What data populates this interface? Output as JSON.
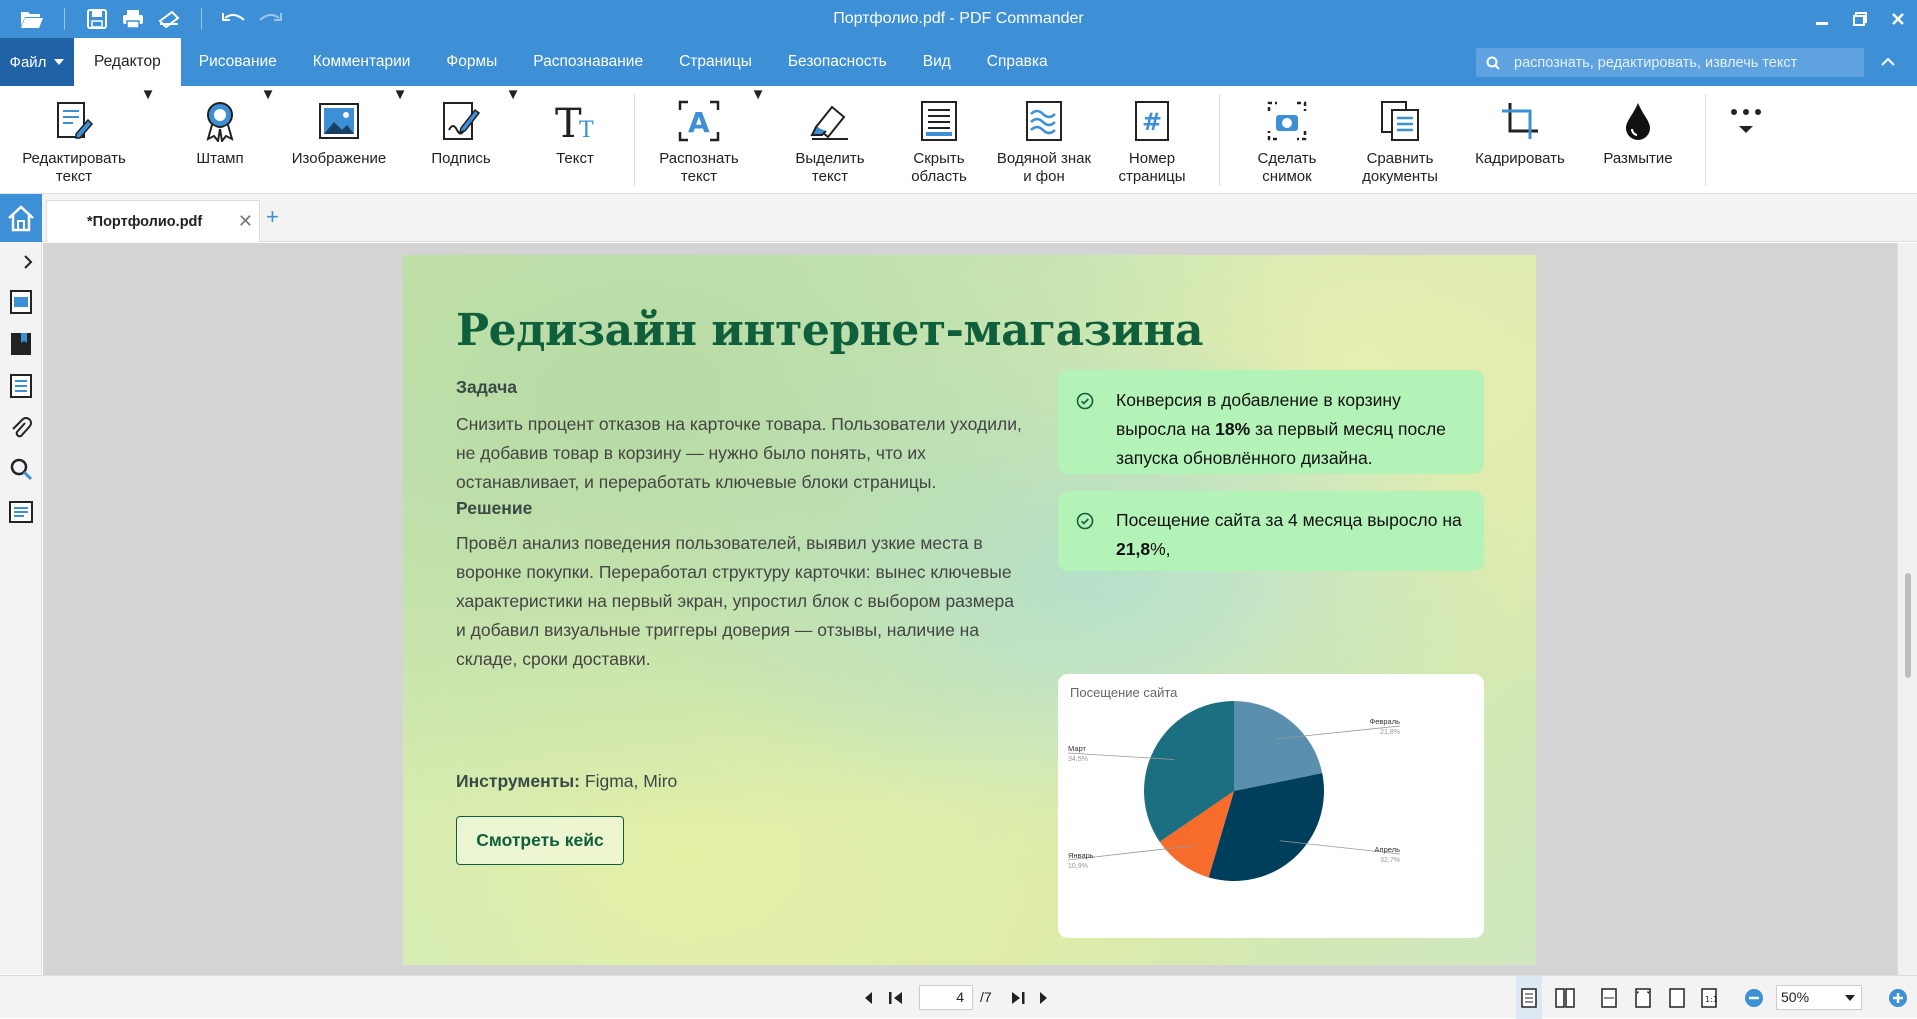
{
  "window": {
    "title": "Портфолио.pdf - PDF Commander"
  },
  "menu": {
    "file_label": "Файл",
    "tabs": [
      "Редактор",
      "Рисование",
      "Комментарии",
      "Формы",
      "Распознавание",
      "Страницы",
      "Безопасность",
      "Вид",
      "Справка"
    ],
    "active_tab": "Редактор"
  },
  "search": {
    "placeholder": "распознать, редактировать, извлечь текст"
  },
  "ribbon": {
    "edit_text": "Редактировать\nтекст",
    "stamp": "Штамп",
    "image": "Изображение",
    "signature": "Подпись",
    "text": "Текст",
    "recognize": "Распознать\nтекст",
    "select_text": "Выделить\nтекст",
    "hide_area": "Скрыть\nобласть",
    "watermark": "Водяной знак\nи фон",
    "page_number": "Номер\nстраницы",
    "snapshot": "Сделать\nснимок",
    "compare": "Сравнить\nдокументы",
    "crop": "Кадрировать",
    "blur": "Размытие"
  },
  "tabs": {
    "doc_name": "*Портфолио.pdf"
  },
  "document": {
    "title": "Редизайн интернет-магазина",
    "task_heading": "Задача",
    "task_text": "Снизить процент отказов на карточке товара. Пользователи уходили, не добавив товар в корзину — нужно было понять, что их останавливает, и переработать ключевые блоки страницы.",
    "solution_heading": "Решение",
    "solution_text": "Провёл анализ поведения пользователей, выявил узкие места в воронке покупки. Переработал структуру карточки: вынес ключевые характеристики на первый экран, упростил блок с выбором размера и добавил визуальные триггеры доверия — отзывы, наличие на складе, сроки доставки.",
    "tools_label": "Инструменты:",
    "tools_value": " Figma, Miro",
    "button_label": "Смотреть кейс",
    "card1_pre": "Конверсия в добавление в корзину выросла на ",
    "card1_bold": "18%",
    "card1_post": " за первый месяц после запуска обновлённого дизайна.",
    "card2_pre": "Посещение сайта за 4 месяца выросло на ",
    "card2_bold": "21,8",
    "card2_post": "%,"
  },
  "chart_data": {
    "type": "pie",
    "title": "Посещение сайта",
    "labels": [
      "Февраль",
      "Апрель",
      "Январь",
      "Март"
    ],
    "display_values": [
      "21,8%",
      "32,7%",
      "10,9%",
      "34,5%"
    ],
    "values": [
      21.8,
      32.7,
      10.9,
      34.5
    ],
    "colors": [
      "#5a8fad",
      "#003f5c",
      "#f76b2b",
      "#1b6f80"
    ]
  },
  "status": {
    "page": "4",
    "total": "/7",
    "zoom": "50%"
  },
  "colors": {
    "accent": "#3d8fd6",
    "menu_dark": "#1f63a6",
    "heading_green": "#0f5f3c",
    "card_green": "#b3f3b7"
  }
}
